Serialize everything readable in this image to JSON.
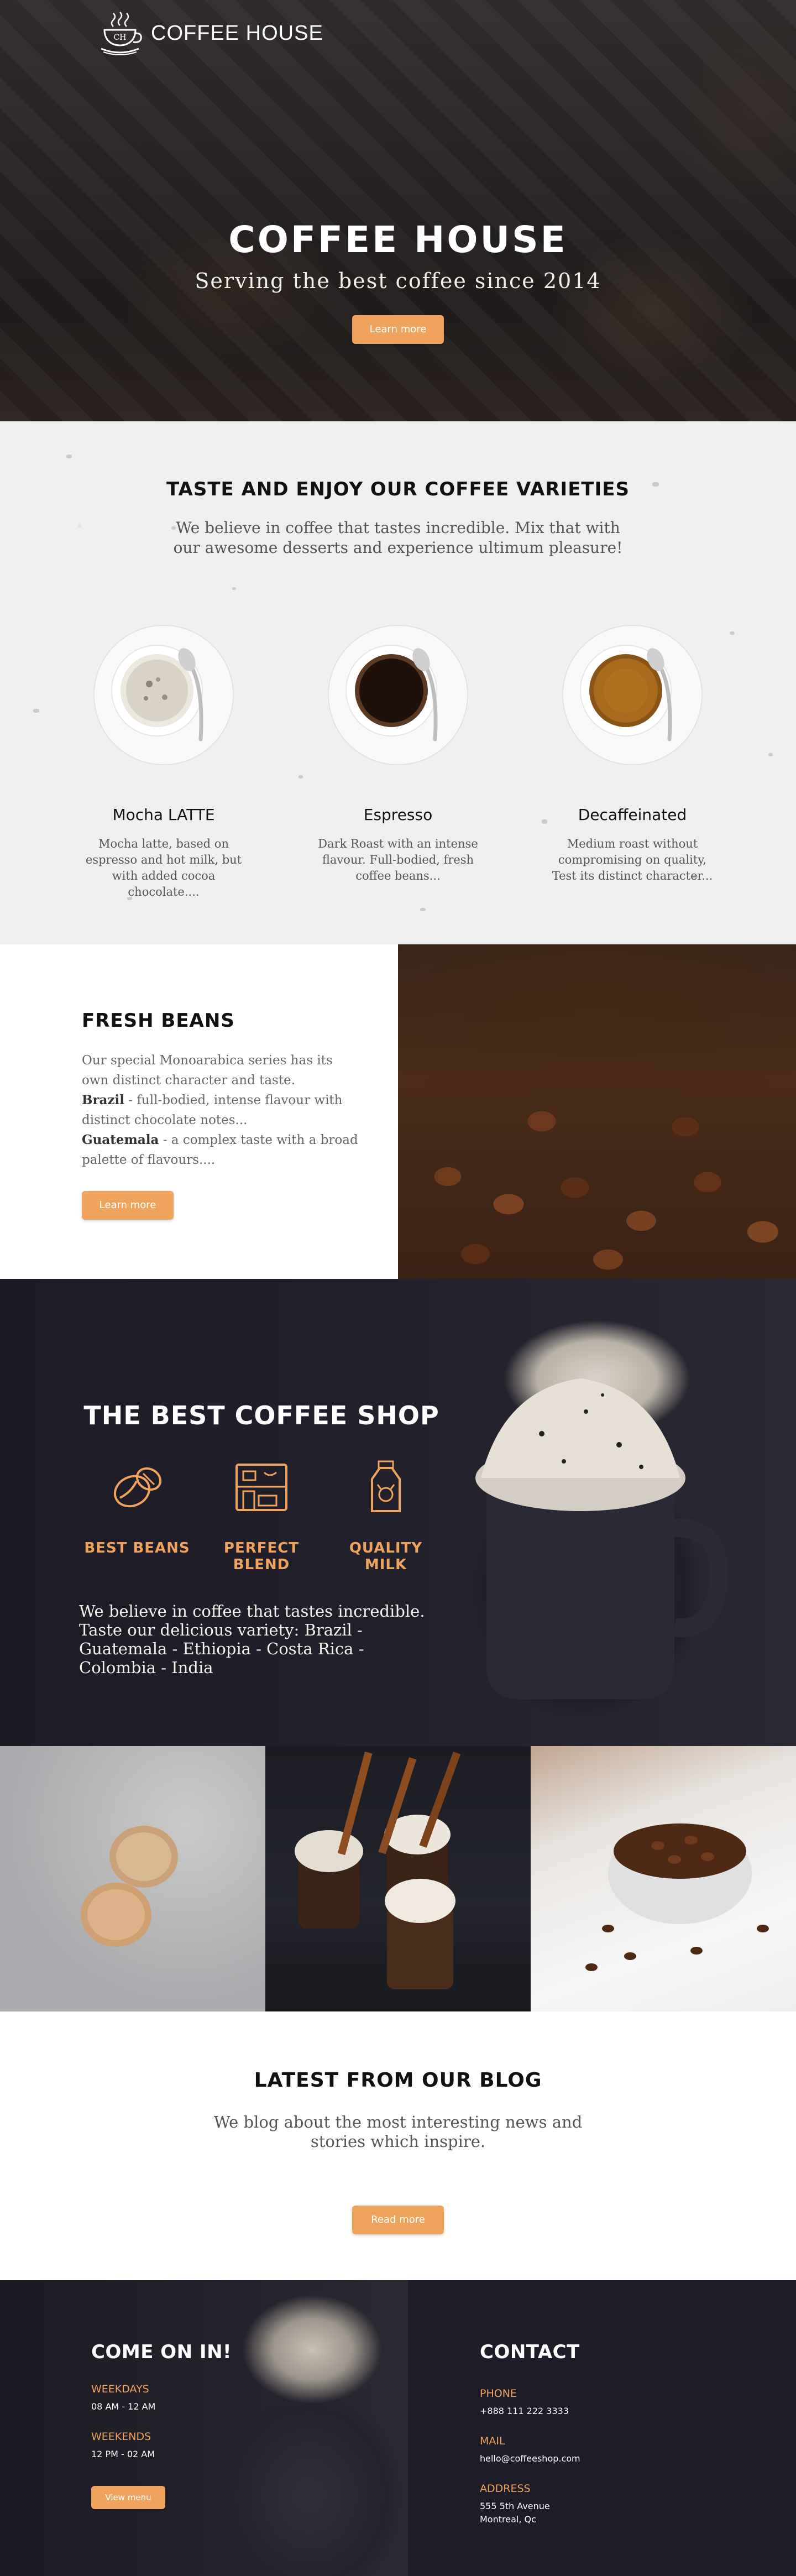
{
  "brand": {
    "logo_monogram": "CH",
    "name": "COFFEE HOUSE"
  },
  "hero": {
    "title": "COFFEE HOUSE",
    "tagline": "Serving the best coffee since 2014",
    "button": "Learn more"
  },
  "varieties": {
    "title": "TASTE AND ENJOY OUR COFFEE VARIETIES",
    "intro": "We believe in coffee that tastes incredible. Mix that with our awesome desserts and experience ultimum pleasure!",
    "items": [
      {
        "name": "Mocha LATTE",
        "desc": "Mocha latte, based on espresso and hot milk, but with added cocoa chocolate...."
      },
      {
        "name": "Espresso",
        "desc": "Dark Roast with an intense flavour. Full-bodied, fresh coffee beans..."
      },
      {
        "name": "Decaffeinated",
        "desc": "Medium roast without compromising on quality, Test its distinct character..."
      }
    ]
  },
  "fresh": {
    "title": "FRESH BEANS",
    "line1": "Our special Monoarabica series has its own distinct character and taste.",
    "brazil_label": "Brazil",
    "brazil_text": " - full-bodied, intense flavour with distinct chocolate notes...",
    "guatemala_label": "Guatemala",
    "guatemala_text": " - a complex taste with a broad palette of flavours....",
    "button": "Learn more"
  },
  "best": {
    "title": "THE BEST COFFEE SHOP",
    "features": [
      {
        "label": "BEST BEANS",
        "icon": "coffee-bean-icon"
      },
      {
        "label": "PERFECT BLEND",
        "icon": "coffee-machine-icon"
      },
      {
        "label": "QUALITY MILK",
        "icon": "milk-bottle-icon"
      }
    ],
    "copy": "We believe in coffee that tastes incredible. Taste our delicious variety: Brazil - Guatemala - Ethiopia - Costa Rica - Colombia - India"
  },
  "blog": {
    "title": "LATEST FROM OUR BLOG",
    "text": "We blog about the most interesting news and stories which inspire.",
    "button": "Read more"
  },
  "footer": {
    "left_title": "COME ON IN!",
    "weekdays_label": "WEEKDAYS",
    "weekdays_hours": "08 AM - 12 AM",
    "weekends_label": "WEEKENDS",
    "weekends_hours": "12 PM - 02 AM",
    "button": "View menu",
    "right_title": "CONTACT",
    "phone_label": "PHONE",
    "phone": "+888 111 222 3333",
    "mail_label": "MAIL",
    "mail": "hello@coffeeshop.com",
    "address_label": "ADDRESS",
    "address_line1": "555 5th Avenue",
    "address_line2": "Montreal, Qc"
  },
  "colors": {
    "accent": "#f0a35c",
    "dark": "#1d1c28",
    "light_bg": "#efefef"
  }
}
